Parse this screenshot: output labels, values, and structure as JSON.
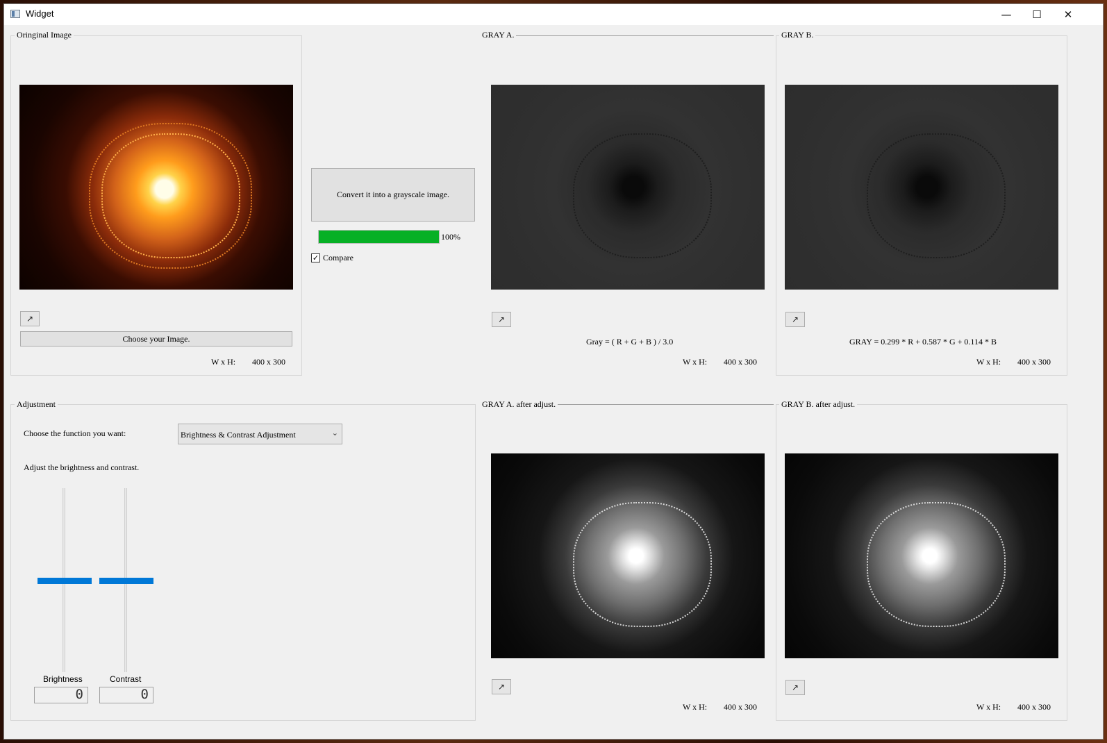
{
  "window": {
    "title": "Widget",
    "minimize_glyph": "—",
    "maximize_glyph": "☐",
    "close_glyph": "✕"
  },
  "original": {
    "group_title": "Oringinal Image",
    "expand_glyph": "↗",
    "choose_button": "Choose your Image.",
    "wh_label": "W x H:",
    "wh_value": "400 x 300"
  },
  "convert": {
    "button": "Convert it into a grayscale image.",
    "progress_percent": 100,
    "progress_label": "100%",
    "compare_label": "Compare",
    "compare_checked": true,
    "check_glyph": "✓"
  },
  "gray_a": {
    "group_title": "GRAY A.",
    "expand_glyph": "↗",
    "formula": "Gray = ( R + G + B ) / 3.0",
    "wh_label": "W x H:",
    "wh_value": "400 x 300"
  },
  "gray_b": {
    "group_title": "GRAY B.",
    "expand_glyph": "↗",
    "formula": "GRAY = 0.299 * R + 0.587 * G + 0.114 * B",
    "wh_label": "W x H:",
    "wh_value": "400 x 300"
  },
  "adjustment": {
    "group_title": "Adjustment",
    "choose_label": "Choose the function you want:",
    "function_selected": "Brightness & Contrast Adjustment",
    "hint": "Adjust the brightness and contrast.",
    "brightness_label": "Brightness",
    "brightness_value": "0",
    "contrast_label": "Contrast",
    "contrast_value": "0",
    "brightness_level": 0.5,
    "contrast_level": 0.5
  },
  "gray_a_adj": {
    "group_title": "GRAY A. after adjust.",
    "expand_glyph": "↗",
    "wh_label": "W x H:",
    "wh_value": "400 x 300"
  },
  "gray_b_adj": {
    "group_title": "GRAY B. after adjust.",
    "expand_glyph": "↗",
    "wh_label": "W x H:",
    "wh_value": "400 x 300"
  },
  "colors": {
    "progress_fill": "#06b025",
    "slider_handle": "#0078d7"
  }
}
